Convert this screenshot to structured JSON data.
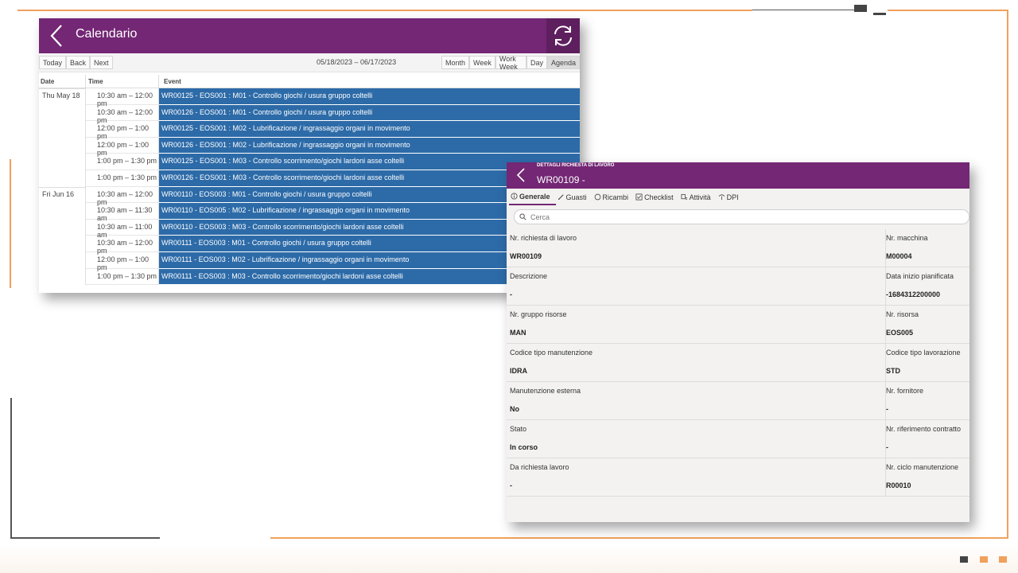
{
  "calendar": {
    "title": "Calendario",
    "toolbar": {
      "nav": [
        "Today",
        "Back",
        "Next"
      ],
      "range": "05/18/2023 – 06/17/2023",
      "views": [
        "Month",
        "Week",
        "Work Week",
        "Day",
        "Agenda"
      ],
      "active_view": "Agenda"
    },
    "columns": {
      "date": "Date",
      "time": "Time",
      "event": "Event"
    },
    "rows": [
      {
        "date": "Thu May 18",
        "time": "10:30 am – 12:00 pm",
        "event": "WR00125 - EOS001 : M01 - Controllo giochi / usura gruppo coltelli"
      },
      {
        "date": "",
        "time": "10:30 am – 12:00 pm",
        "event": "WR00126 - EOS001 : M01 - Controllo giochi / usura gruppo coltelli"
      },
      {
        "date": "",
        "time": "12:00 pm – 1:00 pm",
        "event": "WR00125 - EOS001 : M02 - Lubrificazione / ingrassaggio organi in movimento"
      },
      {
        "date": "",
        "time": "12:00 pm – 1:00 pm",
        "event": "WR00126 - EOS001 : M02 - Lubrificazione / ingrassaggio organi in movimento"
      },
      {
        "date": "",
        "time": "1:00 pm – 1:30 pm",
        "event": "WR00125 - EOS001 : M03 - Controllo scorrimento/giochi lardoni asse coltelli"
      },
      {
        "date": "",
        "time": "1:00 pm – 1:30 pm",
        "event": "WR00126 - EOS001 : M03 - Controllo scorrimento/giochi lardoni asse coltelli"
      },
      {
        "date": "Fri Jun 16",
        "time": "10:30 am – 12:00 pm",
        "event": "WR00110 - EOS003 : M01 - Controllo giochi / usura gruppo coltelli"
      },
      {
        "date": "",
        "time": "10:30 am – 11:30 am",
        "event": "WR00110 - EOS005 : M02 - Lubrificazione / ingrassaggio organi in movimento"
      },
      {
        "date": "",
        "time": "10:30 am – 11:00 am",
        "event": "WR00110 - EOS003 : M03 - Controllo scorrimento/giochi lardoni asse coltelli"
      },
      {
        "date": "",
        "time": "10:30 am – 12:00 pm",
        "event": "WR00111 - EOS003 : M01 - Controllo giochi / usura gruppo coltelli"
      },
      {
        "date": "",
        "time": "12:00 pm – 1:00 pm",
        "event": "WR00111 - EOS003 : M02 - Lubrificazione / ingrassaggio organi in movimento"
      },
      {
        "date": "",
        "time": "1:00 pm – 1:30 pm",
        "event": "WR00111 - EOS003 : M03 - Controllo scorrimento/giochi lardoni asse coltelli"
      }
    ]
  },
  "detail": {
    "kicker": "DETTAGLI RICHIESTA DI LAVORO",
    "title": "WR00109 -",
    "tabs": [
      {
        "label": "Generale",
        "icon": "info-icon"
      },
      {
        "label": "Guasti",
        "icon": "pencil-icon"
      },
      {
        "label": "Ricambi",
        "icon": "circle-icon"
      },
      {
        "label": "Checklist",
        "icon": "checkbox-icon"
      },
      {
        "label": "Attività",
        "icon": "list-icon"
      },
      {
        "label": "DPI",
        "icon": "cone-icon"
      }
    ],
    "search_placeholder": "Cerca",
    "fields": [
      {
        "left_label": "Nr. richiesta di lavoro",
        "left_value": "WR00109",
        "right_label": "Nr. macchina",
        "right_value": "M00004"
      },
      {
        "left_label": "Descrizione",
        "left_value": "-",
        "right_label": "Data inizio pianificata",
        "right_value": "-1684312200000"
      },
      {
        "left_label": "Nr. gruppo risorse",
        "left_value": "MAN",
        "right_label": "Nr. risorsa",
        "right_value": "EOS005"
      },
      {
        "left_label": "Codice tipo manutenzione",
        "left_value": "IDRA",
        "right_label": "Codice tipo lavorazione",
        "right_value": "STD"
      },
      {
        "left_label": "Manutenzione esterna",
        "left_value": "No",
        "right_label": "Nr. fornitore",
        "right_value": "-"
      },
      {
        "left_label": "Stato",
        "left_value": "In corso",
        "right_label": "Nr. riferimento contratto",
        "right_value": "-"
      },
      {
        "left_label": "Da richiesta lavoro",
        "left_value": "-",
        "right_label": "Nr. ciclo manutenzione",
        "right_value": "R00010"
      }
    ]
  },
  "colors": {
    "header_purple": "#732774",
    "event_blue": "#2d6ba8",
    "frame_orange": "#f0a15c"
  }
}
